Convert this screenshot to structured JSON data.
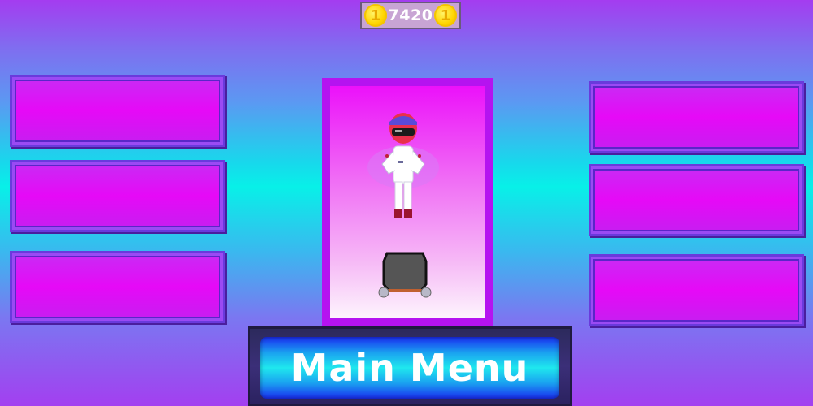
{
  "hud": {
    "coins": "7420",
    "coin_glyph": "1"
  },
  "character": {
    "name": "racer-driver"
  },
  "kart": {
    "name": "kart"
  },
  "main_menu": {
    "label": "Main Menu"
  },
  "colors": {
    "accent": "#b513f0",
    "slot": "#e609f7",
    "coin": "#ffd500"
  },
  "left_slots": [
    {},
    {},
    {}
  ],
  "right_slots": [
    {},
    {},
    {}
  ]
}
